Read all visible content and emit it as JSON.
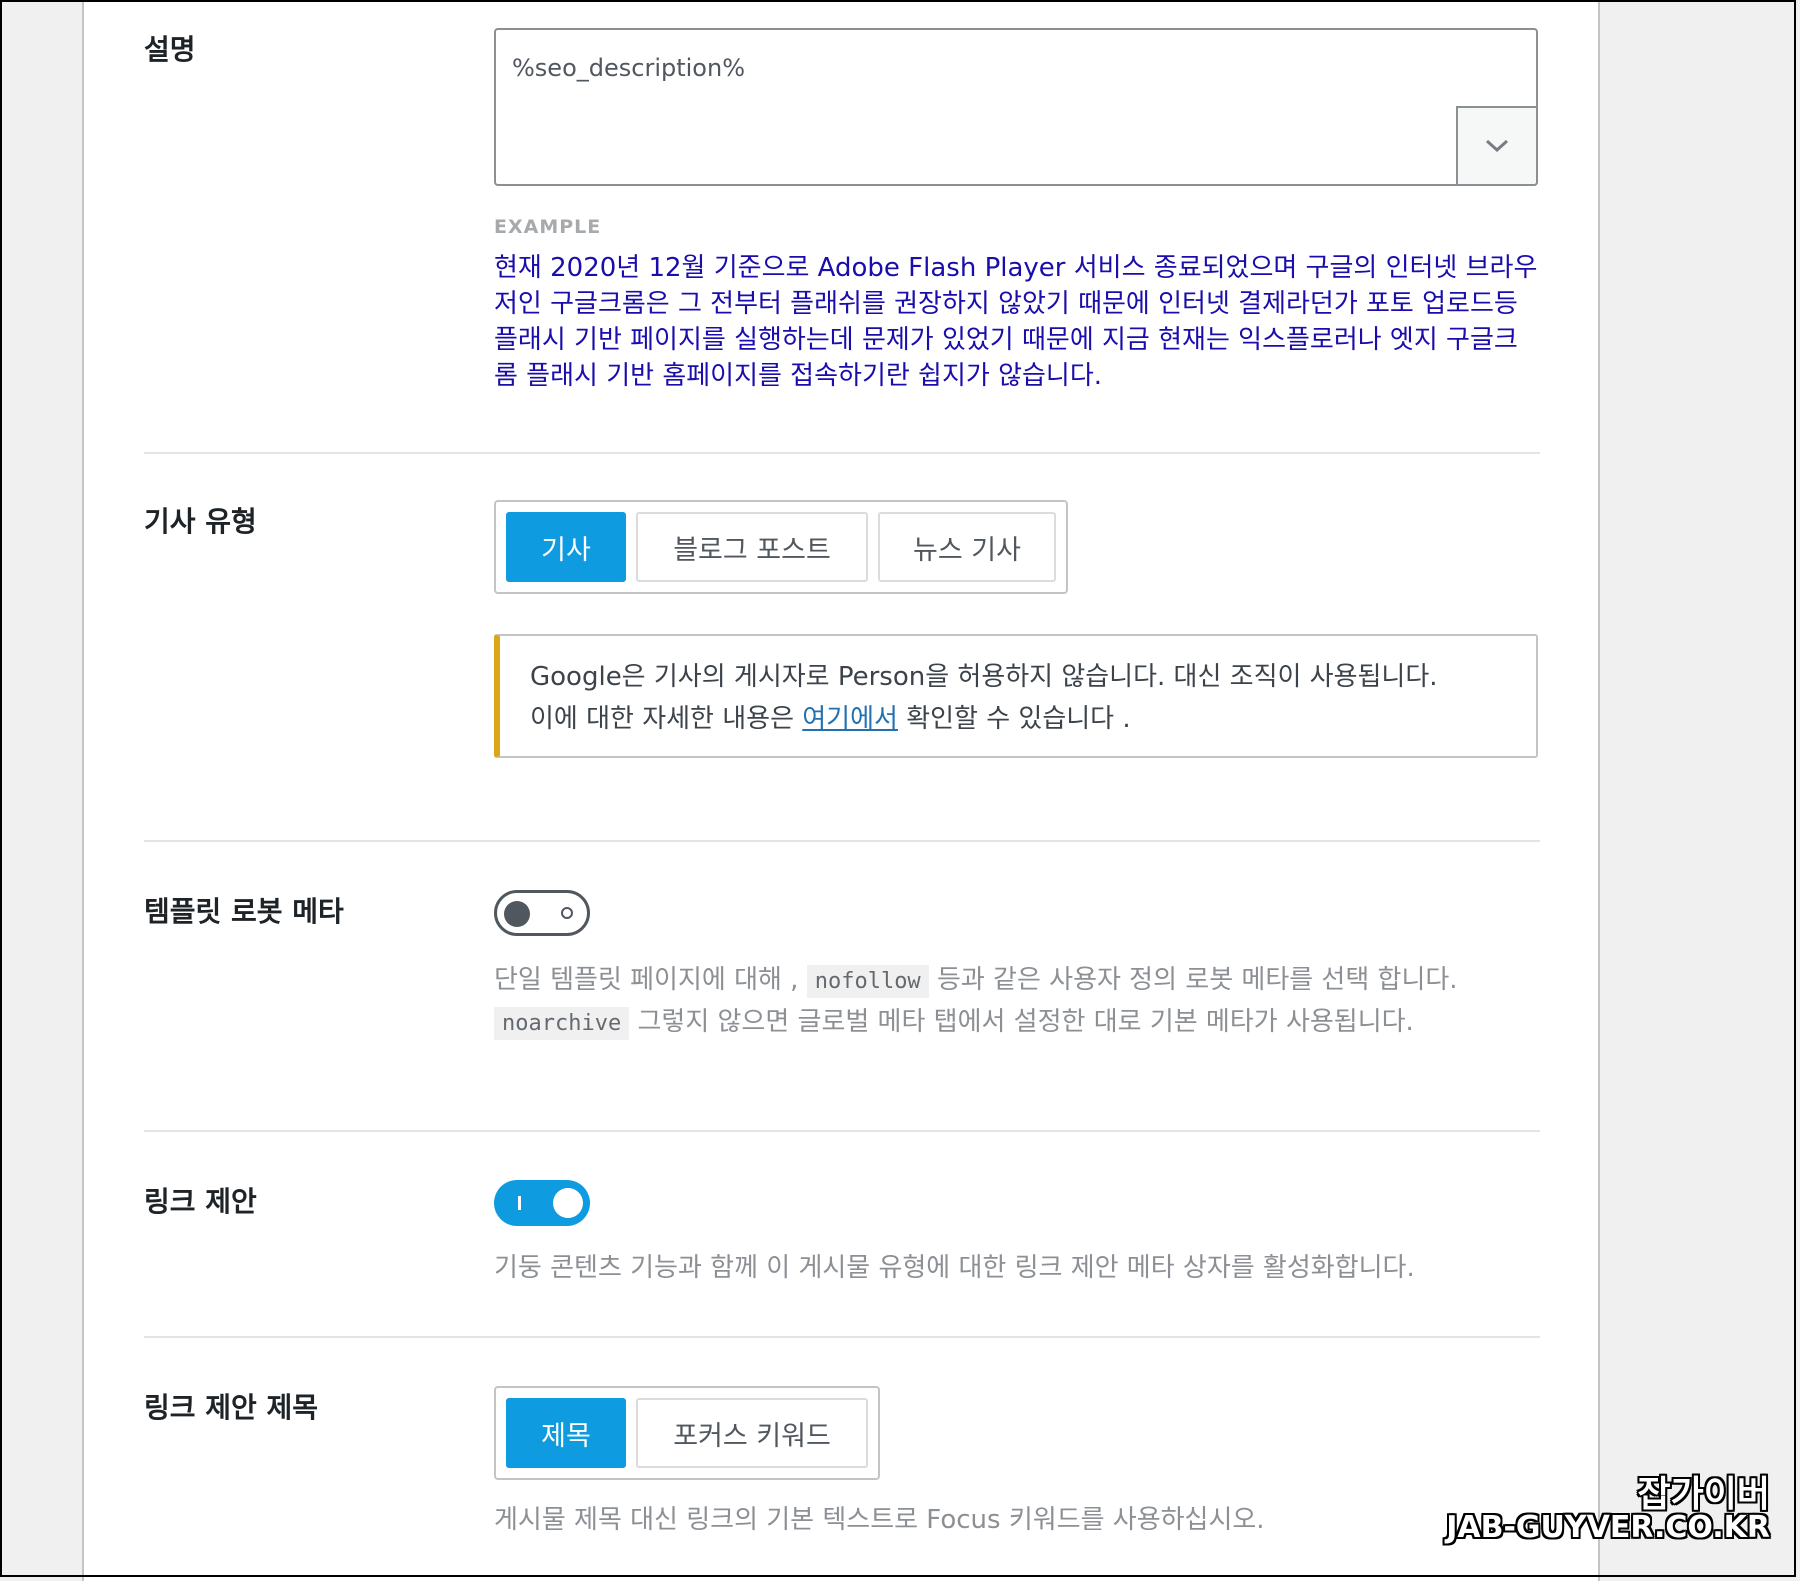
{
  "description": {
    "label": "설명",
    "value": "%seo_description%",
    "variable_button_icon": "chevron-down-icon",
    "example_title": "EXAMPLE",
    "example_text": "현재 2020년 12월 기준으로 Adobe Flash Player 서비스 종료되었으며 구글의 인터넷 브라우저인 구글크롬은 그 전부터 플래쉬를 권장하지 않았기 때문에 인터넷 결제라던가 포토 업로드등 플래시 기반 페이지를 실행하는데 문제가 있었기 때문에 지금 현재는 익스플로러나 엣지 구글크롬 플래시 기반 홈페이지를 접속하기란 쉽지가 않습니다."
  },
  "article_type": {
    "label": "기사 유형",
    "options": [
      "기사",
      "블로그 포스트",
      "뉴스 기사"
    ],
    "selected": "기사",
    "notice_line1": "Google은 기사의 게시자로 Person을 허용하지 않습니다. 대신 조직이 사용됩니다.",
    "notice_line2_prefix": "이에 대한 자세한 내용은 ",
    "notice_link": "여기에서",
    "notice_line2_suffix": " 확인할 수 있습니다 ."
  },
  "robots_meta": {
    "label": "템플릿 로봇 메타",
    "enabled": false,
    "desc_part1": "단일 템플릿 페이지에 대해 , ",
    "code1": "nofollow",
    "desc_part2": " 등과 같은 사용자 정의 로봇 메타를 선택 합니다. ",
    "code2": "noarchive",
    "desc_part3": " 그렇지 않으면 글로벌 메타 탭에서 설정한 대로 기본 메타가 사용됩니다."
  },
  "link_suggestions": {
    "label": "링크 제안",
    "enabled": true,
    "desc": "기둥 콘텐츠 기능과 함께 이 게시물 유형에 대한 링크 제안 메타 상자를 활성화합니다."
  },
  "link_suggestion_title": {
    "label": "링크 제안 제목",
    "options": [
      "제목",
      "포커스 키워드"
    ],
    "selected": "제목",
    "desc": "게시물 제목 대신 링크의 기본 텍스트로 Focus 키워드를 사용하십시오."
  },
  "watermark": {
    "line1": "잡가이버",
    "line2": "JAB-GUYVER.CO.KR"
  },
  "colors": {
    "accent": "#0f9be0",
    "notice_border": "#dba617",
    "example_text": "#1a0dab",
    "link": "#2271b1"
  }
}
